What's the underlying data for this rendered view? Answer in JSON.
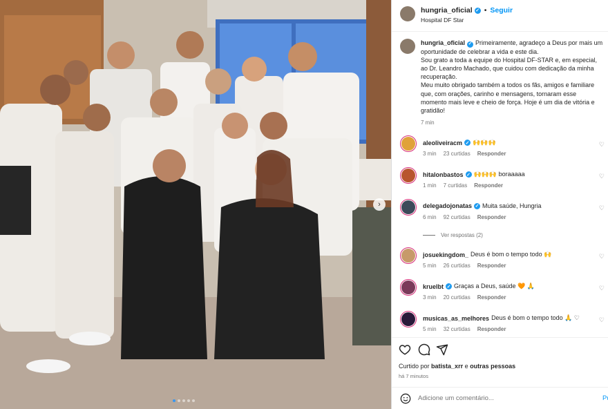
{
  "post": {
    "username": "hungria_oficial",
    "separator": "•",
    "follow_label": "Seguir",
    "location": "Hospital DF Star",
    "caption_lines": [
      "Primeiramente, agradeço a Deus por mais um",
      "oportunidade de celebrar a vida e este dia.",
      "Sou grato a toda a equipe do Hospital DF-STAR e, em especial,",
      "ao Dr. Leandro Machado, que cuidou com dedicação da minha",
      "recuperação.",
      "Meu muito obrigado também a todos os fãs, amigos e familiare",
      "que, com orações, carinho e mensagens, tornaram esse",
      "momento mais leve e cheio de força. Hoje é um dia de vitória e",
      "gratidão!"
    ],
    "caption_time": "7 min"
  },
  "comments": [
    {
      "user": "aleoliveiracm",
      "verified": true,
      "text": "🙌🙌🙌",
      "time": "3 min",
      "likes": "23 curtidas",
      "reply": "Responder",
      "avatar_color": "#e0a23a"
    },
    {
      "user": "hitalonbastos",
      "verified": true,
      "text": "🙌🙌🙌 boraaaaa",
      "time": "1 min",
      "likes": "7 curtidas",
      "reply": "Responder",
      "avatar_color": "#b8552e"
    },
    {
      "user": "delegadojonatas",
      "verified": true,
      "text": "Muita saúde, Hungria",
      "time": "6 min",
      "likes": "92 curtidas",
      "reply": "Responder",
      "avatar_color": "#3c4a5a"
    },
    {
      "user": "josuekingdom_",
      "verified": false,
      "text": "Deus é bom o tempo todo 🙌",
      "time": "5 min",
      "likes": "26 curtidas",
      "reply": "Responder",
      "avatar_color": "#c79a6a"
    },
    {
      "user": "kruelbt",
      "verified": true,
      "text": "Graças a Deus, saúde 🧡 🙏",
      "time": "3 min",
      "likes": "20 curtidas",
      "reply": "Responder",
      "avatar_color": "#7a3a5a"
    },
    {
      "user": "musicas_as_melhores",
      "verified": false,
      "text": "Deus é bom o tempo todo 🙏 ♡",
      "time": "5 min",
      "likes": "32 curtidas",
      "reply": "Responder",
      "avatar_color": "#2a1a3a"
    }
  ],
  "more_replies": "Ver respostas (2)",
  "liked_by": {
    "prefix": "Curtido por",
    "user": "batista_xrr",
    "connector": "e",
    "others": "outras pessoas"
  },
  "post_age": "há 7 minutos",
  "add_comment": {
    "placeholder": "Adicione um comentário...",
    "publish": "Pu"
  },
  "icons": {
    "verified": "verified-badge-icon",
    "like": "heart-icon",
    "comment": "comment-icon",
    "share": "send-icon",
    "emoji": "emoji-icon",
    "next": "chevron-right-icon"
  },
  "colors": {
    "link": "#0095f6",
    "verified": "#1d9bf0",
    "story_ring": "#d62976"
  }
}
